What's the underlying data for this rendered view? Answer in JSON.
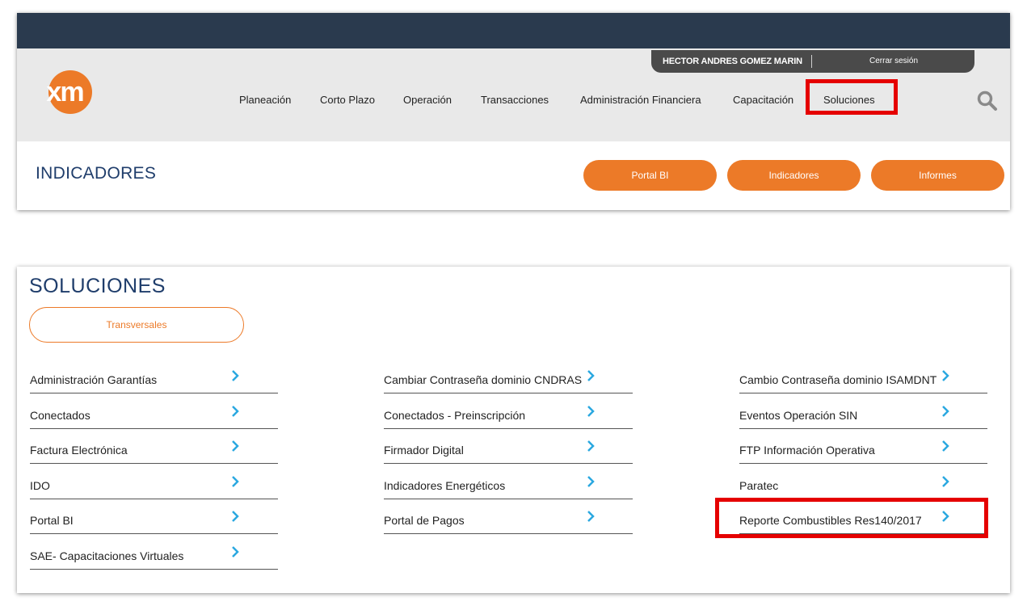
{
  "header": {
    "logo_text": "xm",
    "user_name": "HECTOR ANDRES GOMEZ MARIN",
    "logout_label": "Cerrar sesión",
    "nav_items": [
      "Planeación",
      "Corto Plazo",
      "Operación",
      "Transacciones",
      "Administración Financiera",
      "Capacitación",
      "Soluciones"
    ],
    "search_icon": "search-icon",
    "section_title": "INDICADORES",
    "action_buttons": [
      "Portal BI",
      "Indicadores",
      "Informes"
    ]
  },
  "soluciones": {
    "title": "SOLUCIONES",
    "filter_label": "Transversales",
    "chevron_icon": "chevron-right-icon",
    "columns": [
      [
        "Administración Garantías",
        "Conectados",
        "Factura Electrónica",
        "IDO",
        "Portal BI",
        "SAE- Capacitaciones Virtuales"
      ],
      [
        "Cambiar Contraseña dominio CNDRAS",
        "Conectados - Preinscripción",
        "Firmador Digital",
        "Indicadores Energéticos",
        "Portal de Pagos"
      ],
      [
        "Cambio Contraseña dominio ISAMDNT",
        "Eventos Operación SIN",
        "FTP Información Operativa",
        "Paratec",
        "Reporte Combustibles Res140/2017"
      ]
    ]
  },
  "colors": {
    "topbar": "#2a3a4e",
    "nav_band": "#e9e9e9",
    "accent_orange": "#ec7a28",
    "title_blue": "#1f3d6b",
    "chevron_blue": "#2aa8e0",
    "highlight_red": "#e50000"
  }
}
